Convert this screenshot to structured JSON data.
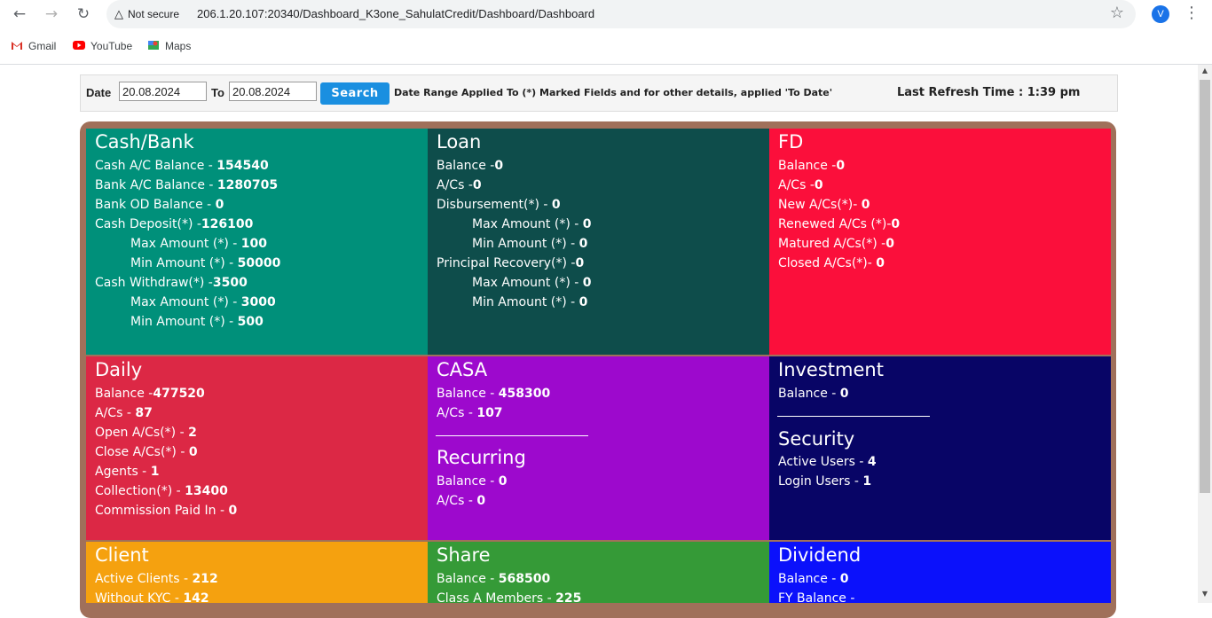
{
  "browser": {
    "not_secure": "Not secure",
    "url": "206.1.20.107:20340/Dashboard_K3one_SahulatCredit/Dashboard/Dashboard",
    "profile_initial": "V",
    "bookmarks": [
      "Gmail",
      "YouTube",
      "Maps"
    ]
  },
  "filter": {
    "date_label": "Date",
    "from_value": "20.08.2024",
    "to_label": "To",
    "to_value": "20.08.2024",
    "search_label": "Search",
    "note": "Date Range Applied To (*) Marked Fields and for other details, applied 'To Date'",
    "refresh_label": "Last Refresh Time",
    "refresh_sep": ":",
    "refresh_value": "1:39 pm"
  },
  "tiles": {
    "cash_bank": {
      "title": "Cash/Bank",
      "color": "#00907a",
      "rows": [
        {
          "label": "Cash A/C Balance - ",
          "value": "154540"
        },
        {
          "label": "Bank A/C Balance - ",
          "value": "1280705"
        },
        {
          "label": "Bank OD Balance - ",
          "value": "0"
        },
        {
          "label": "Cash Deposit(*) -",
          "value": "126100"
        },
        {
          "label": "Max Amount (*) - ",
          "value": "100"
        },
        {
          "label": "Min Amount (*) - ",
          "value": "50000"
        },
        {
          "label": "Cash Withdraw(*) -",
          "value": "3500"
        },
        {
          "label": "Max Amount (*) - ",
          "value": "3000"
        },
        {
          "label": "Min Amount (*) - ",
          "value": "500"
        }
      ]
    },
    "loan": {
      "title": "Loan",
      "color": "#0e4d4b",
      "rows": [
        {
          "label": "Balance -",
          "value": "0"
        },
        {
          "label": "A/Cs -",
          "value": "0"
        },
        {
          "label": "Disbursement(*) - ",
          "value": "0"
        },
        {
          "label": "Max Amount (*) - ",
          "value": "0"
        },
        {
          "label": "Min Amount (*) - ",
          "value": "0"
        },
        {
          "label": "Principal Recovery(*) -",
          "value": "0"
        },
        {
          "label": "Max Amount (*) - ",
          "value": "0"
        },
        {
          "label": "Min Amount (*) - ",
          "value": "0"
        }
      ]
    },
    "fd": {
      "title": "FD",
      "color": "#fb0f3b",
      "rows": [
        {
          "label": "Balance -",
          "value": "0"
        },
        {
          "label": "A/Cs -",
          "value": "0"
        },
        {
          "label": "New A/Cs(*)- ",
          "value": "0"
        },
        {
          "label": "Renewed A/Cs (*)-",
          "value": "0"
        },
        {
          "label": "Matured A/Cs(*) -",
          "value": "0"
        },
        {
          "label": "Closed A/Cs(*)- ",
          "value": "0"
        }
      ]
    },
    "daily": {
      "title": "Daily",
      "color": "#dc2845",
      "rows": [
        {
          "label": "Balance -",
          "value": "477520"
        },
        {
          "label": "A/Cs - ",
          "value": "87"
        },
        {
          "label": "Open A/Cs(*) - ",
          "value": "2"
        },
        {
          "label": "Close A/Cs(*) - ",
          "value": "0"
        },
        {
          "label": "Agents - ",
          "value": "1"
        },
        {
          "label": "Collection(*) - ",
          "value": "13400"
        },
        {
          "label": "Commission Paid In - ",
          "value": "0"
        }
      ]
    },
    "casa": {
      "title": "CASA",
      "color": "#9d09cd",
      "rows": [
        {
          "label": "Balance - ",
          "value": "458300"
        },
        {
          "label": "A/Cs - ",
          "value": "107"
        }
      ],
      "sub_title": "Recurring",
      "sub_rows": [
        {
          "label": "Balance - ",
          "value": "0"
        },
        {
          "label": "A/Cs - ",
          "value": "0"
        }
      ]
    },
    "investment": {
      "title": "Investment",
      "color": "#080566",
      "rows": [
        {
          "label": "Balance - ",
          "value": "0"
        }
      ],
      "sub_title": "Security",
      "sub_rows": [
        {
          "label": "Active Users - ",
          "value": "4"
        },
        {
          "label": "Login Users - ",
          "value": "1"
        }
      ]
    },
    "client": {
      "title": "Client",
      "color": "#f5a10f",
      "rows": [
        {
          "label": "Active Clients - ",
          "value": "212"
        },
        {
          "label": "Without KYC - ",
          "value": "142"
        }
      ]
    },
    "share": {
      "title": "Share",
      "color": "#359a37",
      "rows": [
        {
          "label": "Balance - ",
          "value": "568500"
        },
        {
          "label": "Class A Members - ",
          "value": "225"
        }
      ]
    },
    "dividend": {
      "title": "Dividend",
      "color": "#0b11fb",
      "rows": [
        {
          "label": "Balance - ",
          "value": "0"
        },
        {
          "label": "FY Balance - ",
          "value": ""
        }
      ]
    }
  }
}
